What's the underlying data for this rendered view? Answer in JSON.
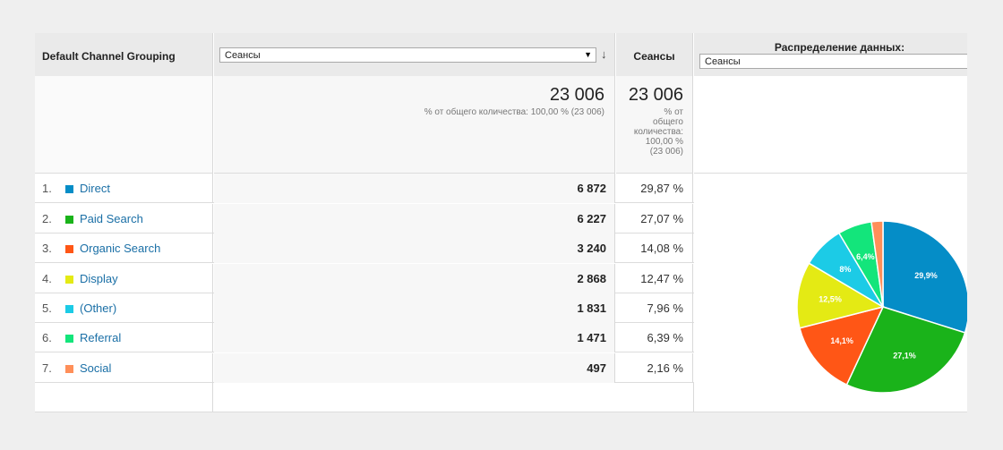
{
  "header": {
    "dimension_label": "Default Channel Grouping",
    "metric_select_value": "Сеансы",
    "sessions_label": "Сеансы",
    "distribution_label": "Распределение данных:",
    "distribution_select_value": "Сеансы"
  },
  "totals": {
    "metric_total": "23 006",
    "metric_note": "% от общего количества: 100,00 % (23 006)",
    "sessions_total": "23 006",
    "sessions_note_lines": [
      "% от",
      "общего",
      "количества:",
      "100,00 %",
      "(23 006)"
    ]
  },
  "rows": [
    {
      "index": "1.",
      "name": "Direct",
      "value": "6 872",
      "pct": "29,87 %",
      "color": "#058dc7"
    },
    {
      "index": "2.",
      "name": "Paid Search",
      "value": "6 227",
      "pct": "27,07 %",
      "color": "#1ab31a"
    },
    {
      "index": "3.",
      "name": "Organic Search",
      "value": "3 240",
      "pct": "14,08 %",
      "color": "#ff5616"
    },
    {
      "index": "4.",
      "name": "Display",
      "value": "2 868",
      "pct": "12,47 %",
      "color": "#e4ea14"
    },
    {
      "index": "5.",
      "name": "(Other)",
      "value": "1 831",
      "pct": "7,96 %",
      "color": "#1ccbe6"
    },
    {
      "index": "6.",
      "name": "Referral",
      "value": "1 471",
      "pct": "6,39 %",
      "color": "#13e57b"
    },
    {
      "index": "7.",
      "name": "Social",
      "value": "497",
      "pct": "2,16 %",
      "color": "#ff8f59"
    }
  ],
  "chart_data": {
    "type": "pie",
    "slices": [
      {
        "value": 29.87,
        "label": "29,9%",
        "color": "#058dc7"
      },
      {
        "value": 27.07,
        "label": "27,1%",
        "color": "#1ab31a"
      },
      {
        "value": 14.08,
        "label": "14,1%",
        "color": "#ff5616"
      },
      {
        "value": 12.47,
        "label": "12,5%",
        "color": "#e4ea14"
      },
      {
        "value": 7.96,
        "label": "8%",
        "color": "#1ccbe6"
      },
      {
        "value": 6.39,
        "label": "6,4%",
        "color": "#13e57b"
      },
      {
        "value": 2.16,
        "label": "",
        "color": "#ff8f59"
      }
    ]
  }
}
